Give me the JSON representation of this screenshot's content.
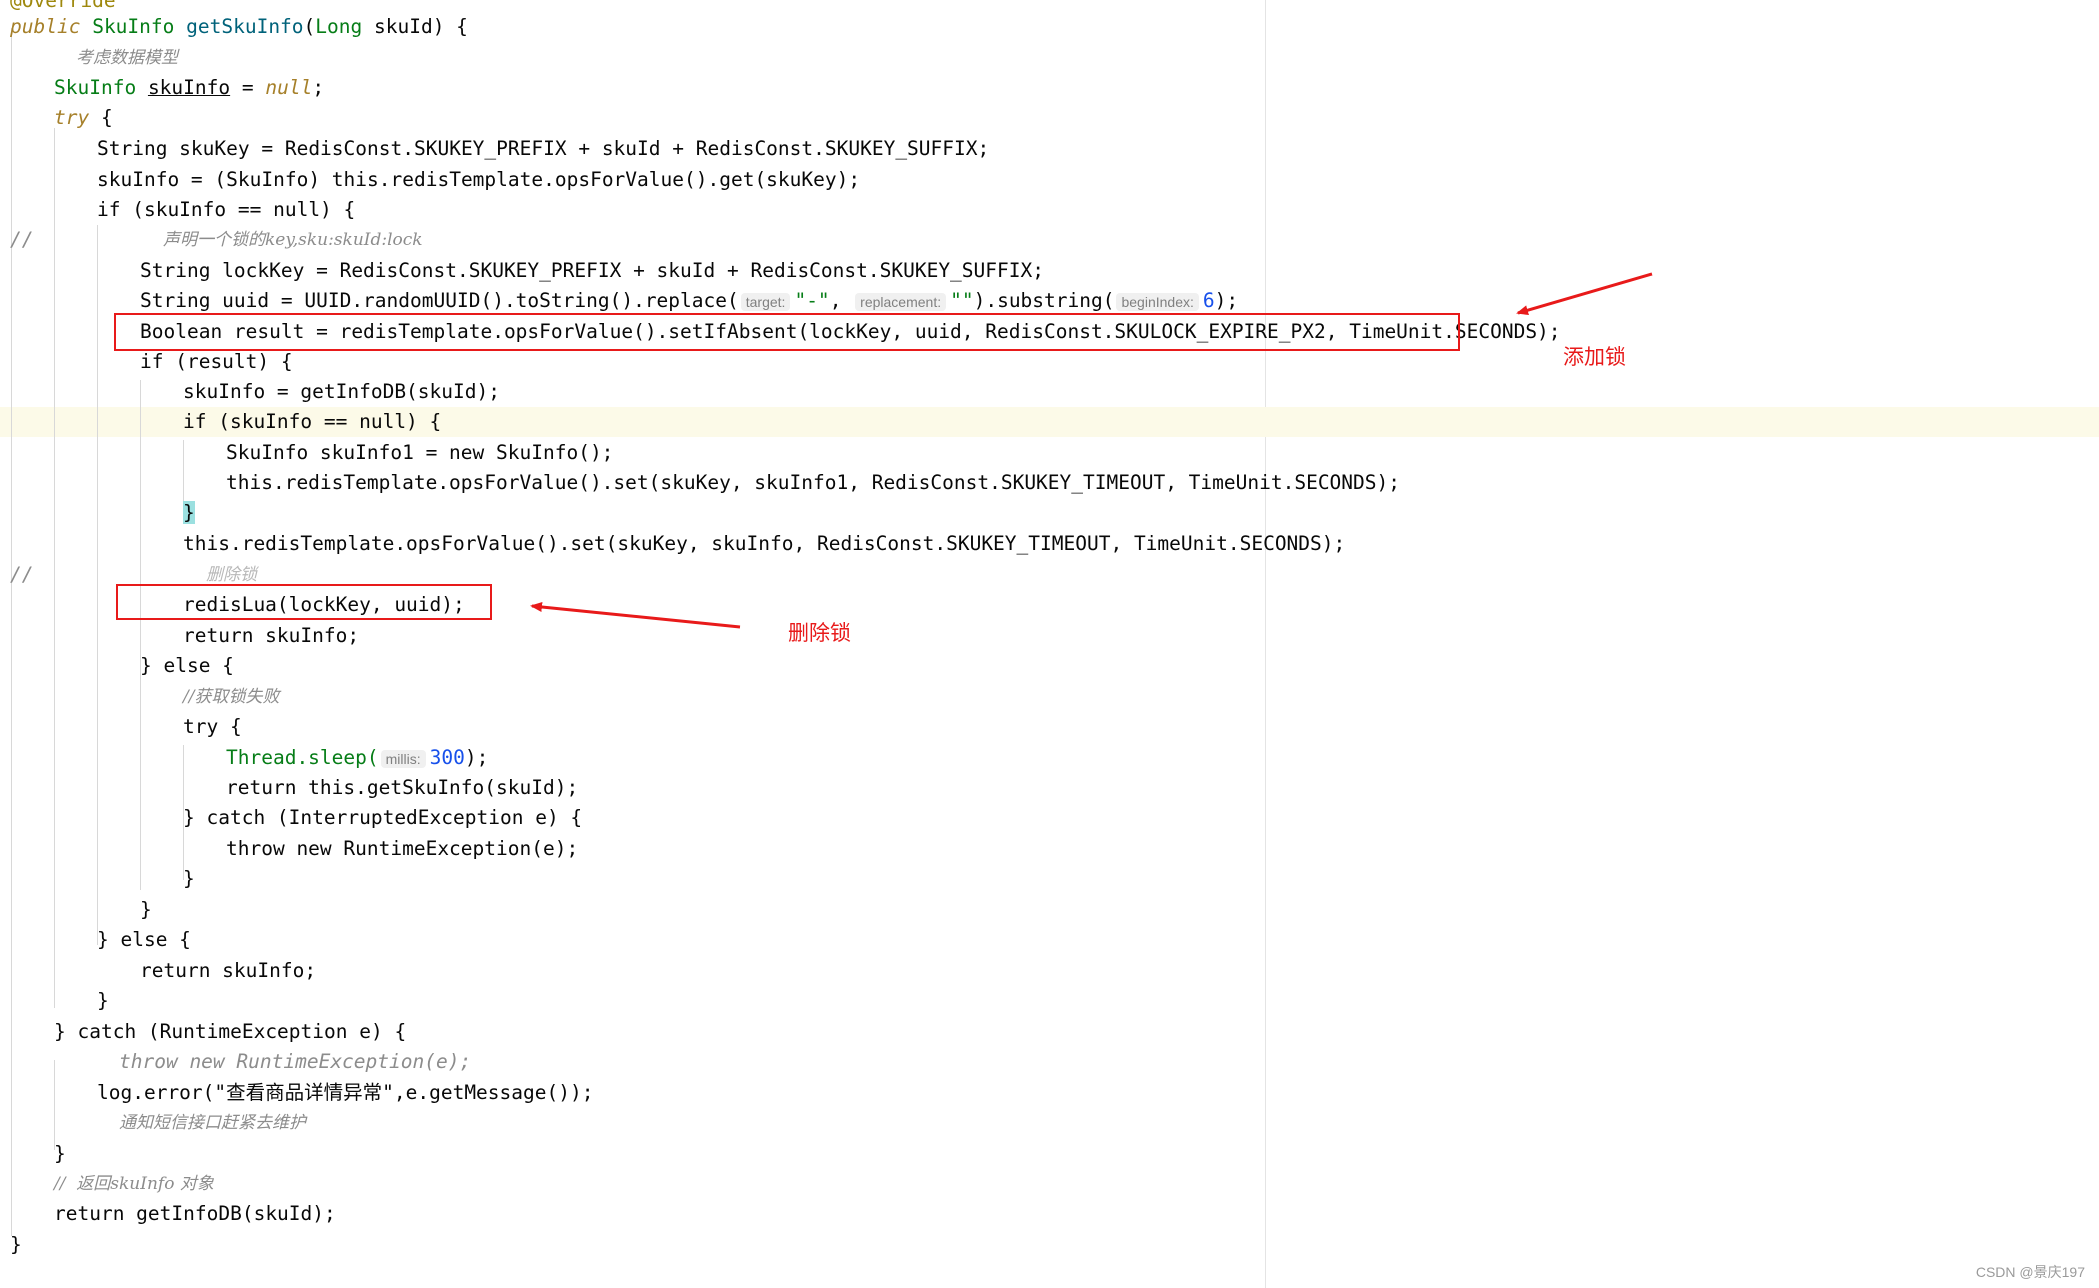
{
  "code": {
    "top_partial": "@Override",
    "lines": {
      "l01_public": "public",
      "l01_type": "SkuInfo",
      "l01_method": "getSkuInfo",
      "l01_paramtype": "Long",
      "l01_rest": " skuId) {",
      "l02_comment": "考虑数据模型",
      "l03_type": "SkuInfo",
      "l03_var": "skuInfo",
      "l03_eq": " = ",
      "l03_null": "null",
      "l04_try": "try",
      "l05_text": "String skuKey = RedisConst.SKUKEY_PREFIX + skuId + RedisConst.SKUKEY_SUFFIX;",
      "l06_text": "skuInfo = (SkuInfo) this.redisTemplate.opsForValue().get(skuKey);",
      "l07_text": "if (skuInfo == null) {",
      "l08_slashes": "//",
      "l08_comment": "声明一个锁的key,sku:skuId:lock",
      "l09_text": "String lockKey = RedisConst.SKUKEY_PREFIX + skuId + RedisConst.SKUKEY_SUFFIX;",
      "l10_text": "String uuid = UUID.randomUUID().toString().replace(",
      "l10_hint1": "target:",
      "l10_hint2": "replacement:",
      "l10_hint3": "beginIndex:",
      "l11_text": "Boolean result = redisTemplate.opsForValue().setIfAbsent(lockKey, uuid, RedisConst.SKULOCK_EXPIRE_PX2, TimeUnit.SECONDS);",
      "l12_text": "if (result) {",
      "l13_text": "skuInfo = getInfoDB(skuId);",
      "l14_text": "if (skuInfo == null) {",
      "l15_text": "SkuInfo skuInfo1 = new SkuInfo();",
      "l16_text": "this.redisTemplate.opsForValue().set(skuKey, skuInfo1, RedisConst.SKUKEY_TIMEOUT, TimeUnit.SECONDS);",
      "l17_text": "}",
      "l18_text": "this.redisTemplate.opsForValue().set(skuKey, skuInfo, RedisConst.SKUKEY_TIMEOUT, TimeUnit.SECONDS);",
      "l19_slashes": "//",
      "l19_comment": "删除锁",
      "l20_text": "redisLua(lockKey, uuid);",
      "l21_text": "return skuInfo;",
      "l22_text": "} else {",
      "l23_comment": "//获取锁失败",
      "l24_text": "try {",
      "l25_text": "Thread.sleep(",
      "l25_hint": "millis:",
      "l26_text": "return this.getSkuInfo(skuId);",
      "l27_text": "} catch (InterruptedException e) {",
      "l28_text": "throw new RuntimeException(e);",
      "l29_text": "}",
      "l30_text": "}",
      "l31_text": "} else {",
      "l32_text": "return skuInfo;",
      "l33_text": "}",
      "l34_text": "} catch (RuntimeException e) {",
      "l35_comment": "throw new RuntimeException(e);",
      "l36_text": "log.error(\"查看商品详情异常\",e.getMessage());",
      "l37_comment": "通知短信接口赶紧去维护",
      "l38_text": "}",
      "l39_comment": "//  返回skuInfo 对象",
      "l40_text": "return getInfoDB(skuId);",
      "l41_text": "}"
    }
  },
  "annotations": {
    "add_lock": "添加锁",
    "delete_lock": "删除锁"
  },
  "watermark": "CSDN @景庆197",
  "colors": {
    "annotation_red": "#e81a1a",
    "keyword": "#a6802a",
    "type": "#067d17",
    "constant": "#871094",
    "field": "#8a5bd6",
    "number": "#1750eb",
    "comment": "#8c8c8c",
    "current_line": "#fcfae8"
  }
}
